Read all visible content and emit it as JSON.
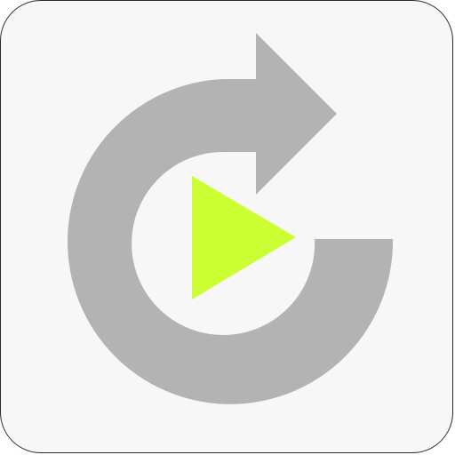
{
  "icon": {
    "name": "replay-icon",
    "colors": {
      "tile_background": "#f7f7f7",
      "tile_border": "#2a2a2a",
      "arrow_ring": "#b3b3b3",
      "play_triangle": "#ccff33"
    }
  }
}
